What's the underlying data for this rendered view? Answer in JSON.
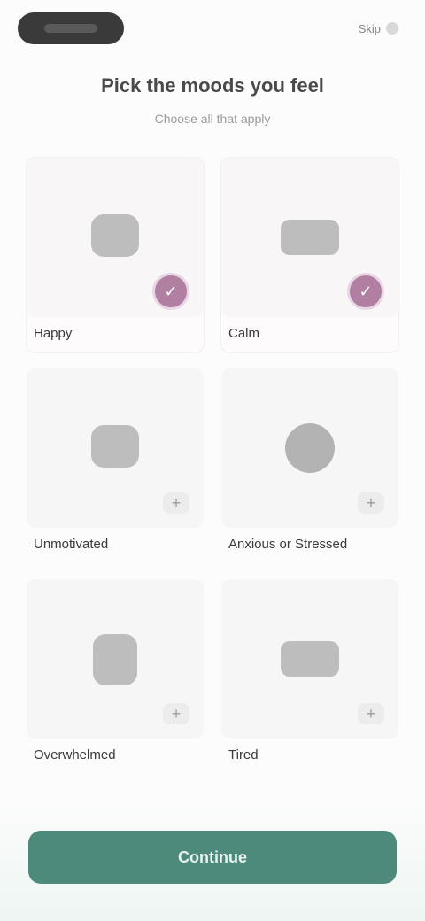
{
  "topbar": {
    "account_label": "",
    "right_text": "Skip",
    "icon": "help-icon"
  },
  "header": {
    "title": "Pick the moods you feel",
    "subtitle": "Choose all that apply"
  },
  "moods": [
    {
      "label": "Happy",
      "selected": true,
      "icon": "happy-face-icon"
    },
    {
      "label": "Calm",
      "selected": true,
      "icon": "calm-face-icon"
    },
    {
      "label": "Unmotivated",
      "selected": false,
      "icon": "unmotivated-face-icon"
    },
    {
      "label": "Anxious or Stressed",
      "selected": false,
      "icon": "anxious-face-icon"
    },
    {
      "label": "Overwhelmed",
      "selected": false,
      "icon": "overwhelmed-face-icon"
    },
    {
      "label": "Tired",
      "selected": false,
      "icon": "tired-face-icon"
    }
  ],
  "selected_mark": "✓",
  "unselected_mark": "+",
  "cta": {
    "label": "Continue"
  },
  "colors": {
    "accent": "#4e8a7c",
    "selected_badge": "#b07fa1"
  }
}
